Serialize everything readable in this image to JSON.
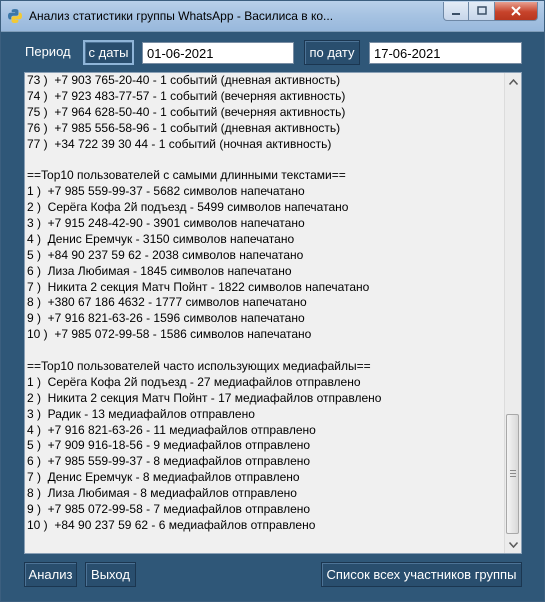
{
  "window": {
    "title": "Анализ статистики группы WhatsApp - Василиса в ко..."
  },
  "toolbar": {
    "period_label": "Период",
    "from_button": "с даты",
    "from_value": "01-06-2021",
    "to_button": "по дату",
    "to_value": "17-06-2021"
  },
  "log": {
    "lines": [
      "73 )  +7 903 765-20-40 - 1 событий (дневная активность)",
      "74 )  +7 923 483-77-57 - 1 событий (вечерняя активность)",
      "75 )  +7 964 628-50-40 - 1 событий (вечерняя активность)",
      "76 )  +7 985 556-58-96 - 1 событий (дневная активность)",
      "77 )  +34 722 39 30 44 - 1 событий (ночная активность)",
      "",
      "==Top10 пользователей с самыми длинными текстами==",
      "1 )  +7 985 559-99-37 - 5682 символов напечатано",
      "2 )  Серёга Кофа 2й подъезд - 5499 символов напечатано",
      "3 )  +7 915 248-42-90 - 3901 символов напечатано",
      "4 )  Денис Еремчук - 3150 символов напечатано",
      "5 )  +84 90 237 59 62 - 2038 символов напечатано",
      "6 )  Лиза Любимая - 1845 символов напечатано",
      "7 )  Никита 2 секция Матч Пойнт - 1822 символов напечатано",
      "8 )  +380 67 186 4632 - 1777 символов напечатано",
      "9 )  +7 916 821-63-26 - 1596 символов напечатано",
      "10 )  +7 985 072-99-58 - 1586 символов напечатано",
      "",
      "==Top10 пользователей часто использующих медиафайлы==",
      "1 )  Серёга Кофа 2й подъезд - 27 медиафайлов отправлено",
      "2 )  Никита 2 секция Матч Пойнт - 17 медиафайлов отправлено",
      "3 )  Радик - 13 медиафайлов отправлено",
      "4 )  +7 916 821-63-26 - 11 медиафайлов отправлено",
      "5 )  +7 909 916-18-56 - 9 медиафайлов отправлено",
      "6 )  +7 985 559-99-37 - 8 медиафайлов отправлено",
      "7 )  Денис Еремчук - 8 медиафайлов отправлено",
      "8 )  Лиза Любимая - 8 медиафайлов отправлено",
      "9 )  +7 985 072-99-58 - 7 медиафайлов отправлено",
      "10 )  +84 90 237 59 62 - 6 медиафайлов отправлено"
    ]
  },
  "bottom": {
    "analyze_button": "Анализ",
    "exit_button": "Выход",
    "members_button": "Список всех участников группы"
  },
  "colors": {
    "window_bg": "#2f5778",
    "button_bg": "#294e6e",
    "text_area_bg": "#f0f0f0"
  }
}
